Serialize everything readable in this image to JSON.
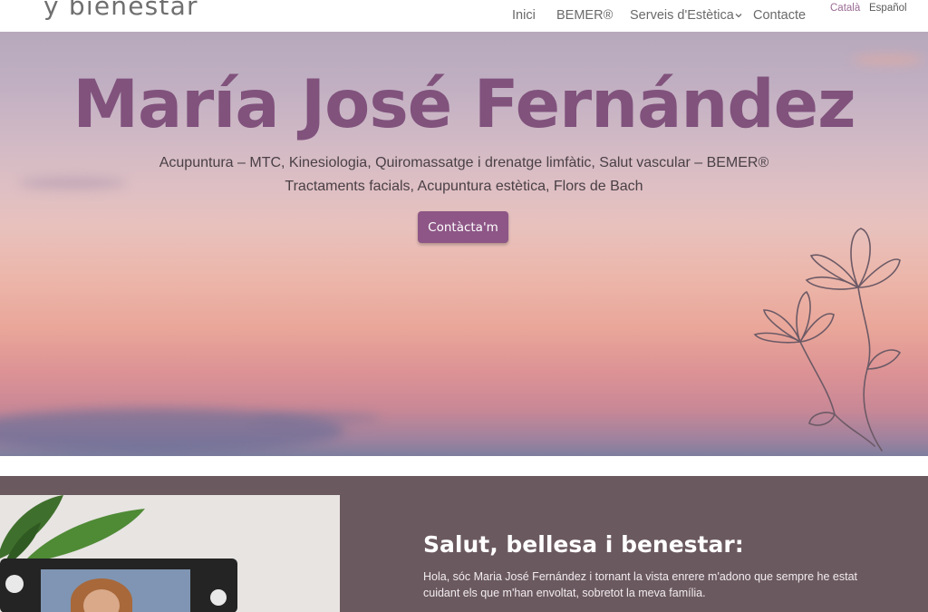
{
  "header": {
    "logo_text": "y bienestar",
    "nav": [
      {
        "label": "Inici"
      },
      {
        "label": "BEMER®"
      },
      {
        "label": "Serveis d'Estètica"
      },
      {
        "label": "Contacte"
      }
    ],
    "languages": [
      {
        "label": "Català",
        "active": true
      },
      {
        "label": "Español",
        "active": false
      }
    ]
  },
  "hero": {
    "title": "María José Fernández",
    "subtitle_line1": "Acupuntura – MTC, Kinesiologia, Quiromassatge i drenatge limfàtic, Salut vascular – BEMER®",
    "subtitle_line2": "Tractaments facials, Acupuntura estètica, Flors de Bach",
    "cta_label": "Contàcta'm"
  },
  "about": {
    "heading": "Salut, bellesa i benestar:",
    "paragraph_line1": "Hola, sóc Maria José Fernández i tornant la vista enrere m'adono que sempre he estat",
    "paragraph_line2": "cuidant els que m'han envoltat, sobretot la meva família."
  },
  "colors": {
    "brand_purple": "#80527c",
    "button_purple": "#8d5686",
    "section_bg": "#6b5960",
    "active_language": "#9a6b93"
  },
  "icons": {
    "flower": "flower-line-art-icon",
    "chevron": "chevron-down-icon"
  }
}
